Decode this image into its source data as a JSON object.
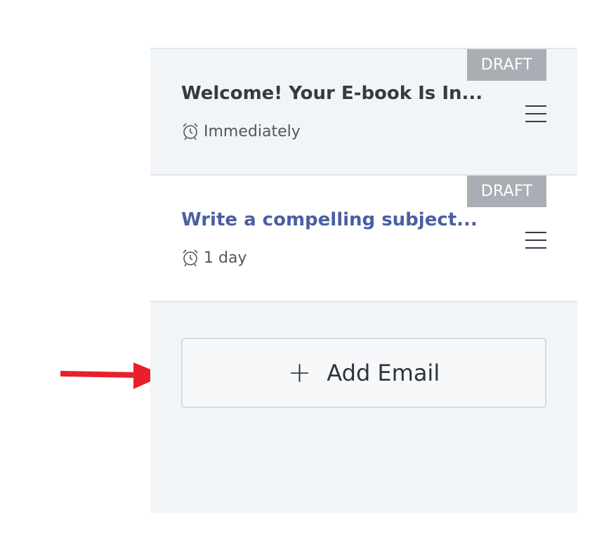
{
  "emails": [
    {
      "badge": "DRAFT",
      "title": "Welcome! Your E-book Is In...",
      "timing_icon": "alarm-clock-icon",
      "timing": "Immediately",
      "title_color": "#333b45"
    },
    {
      "badge": "DRAFT",
      "title": "Write a compelling subject...",
      "timing_icon": "alarm-clock-icon",
      "timing": "1 day",
      "title_color": "#4a5fa4"
    }
  ],
  "add_button": {
    "icon": "plus-icon",
    "label": "Add Email"
  },
  "annotation": {
    "arrow_color": "#e8202a"
  }
}
